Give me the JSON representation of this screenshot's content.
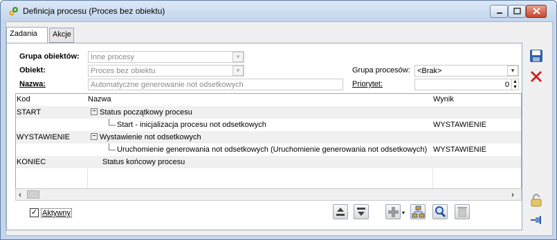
{
  "window": {
    "title": "Definicja procesu (Proces bez obiektu)"
  },
  "tabs": [
    {
      "label": "Zadania"
    },
    {
      "label": "Akcje"
    }
  ],
  "form": {
    "grupa_obiektow_label": "Grupa obiektów:",
    "grupa_obiektow_value": "Inne procesy",
    "obiekt_label": "Obiekt:",
    "obiekt_value": "Proces bez obiektu",
    "nazwa_label": "Nazwa:",
    "nazwa_value": "Automatyczne generowanie not odsetkowych",
    "grupa_procesow_label": "Grupa procesów:",
    "grupa_procesow_value": "<Brak>",
    "priorytet_label": "Priorytet:",
    "priorytet_value": "0"
  },
  "grid": {
    "columns": [
      "Kod",
      "Nazwa",
      "Wynik"
    ],
    "rows": [
      {
        "kod": "START",
        "nazwa": "Status początkowy procesu",
        "wynik": "",
        "level": 0,
        "toggle": "−"
      },
      {
        "kod": "",
        "nazwa": "Start - inicjalizacja procesu not odsetkowych",
        "wynik": "WYSTAWIENIE",
        "level": 1,
        "toggle": ""
      },
      {
        "kod": "WYSTAWIENIE",
        "nazwa": "Wystawienie not odsetkowych",
        "wynik": "",
        "level": 0,
        "toggle": "−"
      },
      {
        "kod": "",
        "nazwa": "Uruchomienie generowania not odsetkowych (Uruchomienie generowania not odsetkowych)",
        "wynik": "WYSTAWIENIE",
        "level": 1,
        "toggle": ""
      },
      {
        "kod": "KONIEC",
        "nazwa": "Status końcowy procesu",
        "wynik": "",
        "level": 0,
        "toggle": ""
      }
    ]
  },
  "footer": {
    "aktywny_label": "Aktywny",
    "aktywny_checked": true
  },
  "colors": {
    "save": "#2f5fa8",
    "delete": "#d12020",
    "toolbar_green": "#3a9a2a"
  }
}
